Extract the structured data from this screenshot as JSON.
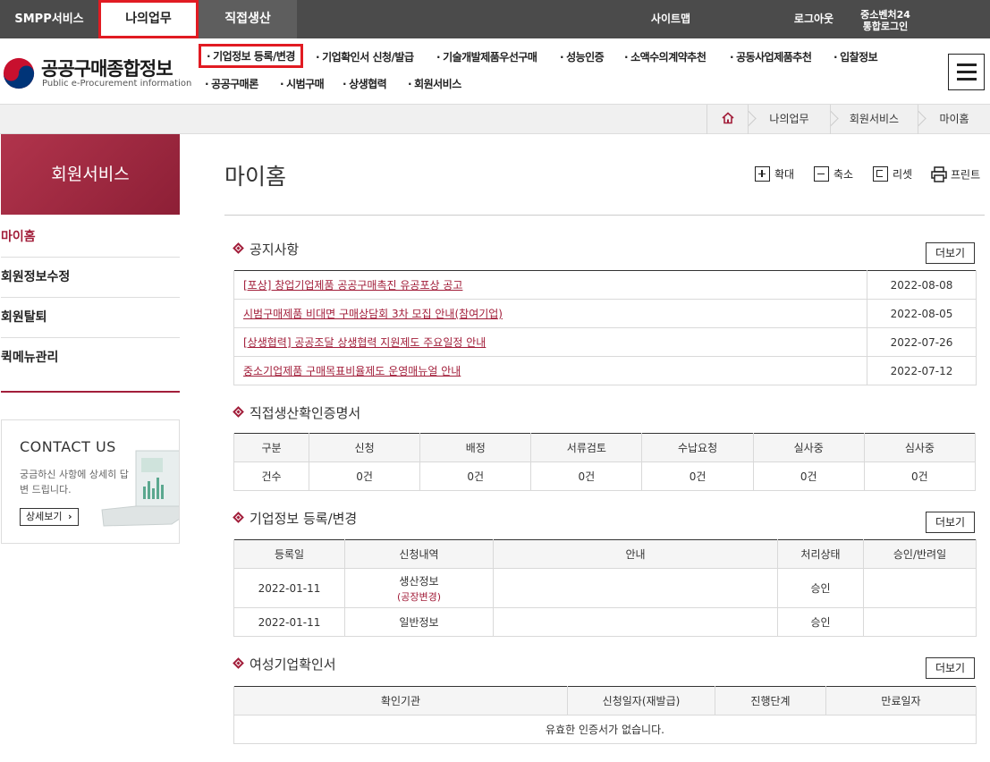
{
  "topnav": {
    "smpp": "SMPP서비스",
    "mywork": "나의업무",
    "direct": "직접생산",
    "sitemap": "사이트맵",
    "logout": "로그아웃",
    "sme24_line1": "중소벤처24",
    "sme24_line2": "통합로그인"
  },
  "logo": {
    "title": "공공구매종합정보",
    "subtitle": "Public e-Procurement information"
  },
  "gnb": {
    "items": [
      "기업정보 등록/변경",
      "기업확인서 신청/발급",
      "기술개발제품우선구매",
      "성능인증",
      "소액수의계약추천",
      "공동사업제품추천",
      "입찰정보",
      "공공구매론",
      "시범구매",
      "상생협력",
      "회원서비스"
    ]
  },
  "breadcrumb": [
    "나의업무",
    "회원서비스",
    "마이홈"
  ],
  "sidebar": {
    "title": "회원서비스",
    "items": [
      "마이홈",
      "회원정보수정",
      "회원탈퇴",
      "퀵메뉴관리"
    ]
  },
  "contact": {
    "title": "CONTACT US",
    "desc": "궁금하신 사항에 상세히 답변 드립니다.",
    "button": "상세보기"
  },
  "page": {
    "title": "마이홈",
    "tools": [
      "확대",
      "축소",
      "리셋",
      "프린트"
    ],
    "more": "더보기"
  },
  "notice": {
    "title": "공지사항",
    "rows": [
      {
        "title": "[포상] 창업기업제품 공공구매촉진 유공포상 공고",
        "date": "2022-08-08"
      },
      {
        "title": "시범구매제품 비대면 구매상담회 3차 모집 안내(참여기업)",
        "date": "2022-08-05"
      },
      {
        "title": "[상생협력] 공공조달 상생협력 지원제도 주요일정 안내",
        "date": "2022-07-26"
      },
      {
        "title": "중소기업제품 구매목표비율제도 운영매뉴얼 안내",
        "date": "2022-07-12"
      }
    ]
  },
  "direct_cert": {
    "title": "직접생산확인증명서",
    "headers": [
      "구분",
      "신청",
      "배정",
      "서류검토",
      "수납요청",
      "실사중",
      "심사중"
    ],
    "row": [
      "건수",
      "0건",
      "0건",
      "0건",
      "0건",
      "0건",
      "0건"
    ]
  },
  "company_info": {
    "title": "기업정보 등록/변경",
    "headers": [
      "등록일",
      "신청내역",
      "안내",
      "처리상태",
      "승인/반려일"
    ],
    "rows": [
      {
        "date": "2022-01-11",
        "item": "생산정보",
        "sub": "(공장변경)",
        "guide": "",
        "status": "승인",
        "approved": ""
      },
      {
        "date": "2022-01-11",
        "item": "일반정보",
        "sub": "",
        "guide": "",
        "status": "승인",
        "approved": ""
      }
    ]
  },
  "women_cert": {
    "title": "여성기업확인서",
    "headers": [
      "확인기관",
      "신청일자(재발급)",
      "진행단계",
      "만료일자"
    ],
    "empty": "유효한 인증서가 없습니다."
  },
  "colors": {
    "accent": "#a21e3a",
    "highlight_border": "#e11b22",
    "topnav_bg": "#4b4b4b"
  }
}
